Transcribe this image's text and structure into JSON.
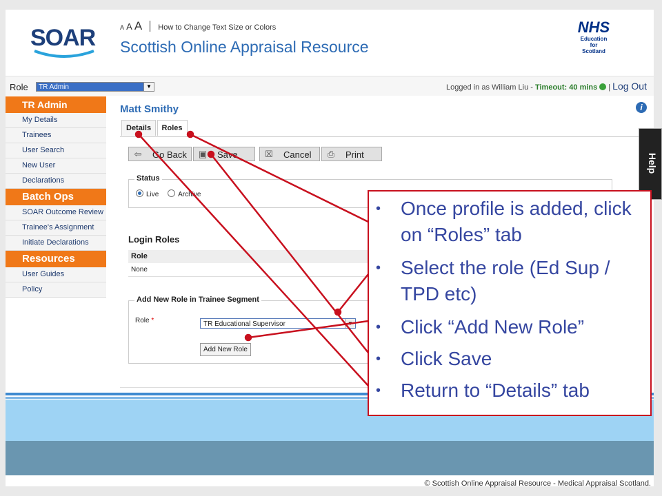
{
  "header": {
    "logo": "SOAR",
    "text_size": {
      "a_small": "A",
      "a_medium": "A",
      "a_large": "A",
      "link": "How to Change Text Size or Colors"
    },
    "site_title": "Scottish Online Appraisal Resource",
    "nhs": {
      "mark": "NHS",
      "line1": "Education",
      "line2": "for",
      "line3": "Scotland"
    }
  },
  "role_bar": {
    "label": "Role",
    "selected": "TR Admin",
    "logged_in": "Logged in as William Liu - ",
    "timeout": "Timeout: 40 mins",
    "logout": "Log Out"
  },
  "sidebar": {
    "sections": [
      {
        "title": "TR Admin",
        "items": [
          "My Details",
          "Trainees",
          "User Search",
          "New User",
          "Declarations"
        ]
      },
      {
        "title": "Batch Ops",
        "items": [
          "SOAR Outcome Review",
          "Trainee's Assignment",
          "Initiate Declarations"
        ]
      },
      {
        "title": "Resources",
        "items": [
          "User Guides",
          "Policy"
        ]
      }
    ]
  },
  "main": {
    "person_name": "Matt Smithy",
    "tabs": [
      {
        "label": "Details"
      },
      {
        "label": "Roles"
      }
    ],
    "toolbar": {
      "go_back": "Go Back",
      "save": "Save",
      "cancel": "Cancel",
      "print": "Print"
    },
    "status": {
      "legend": "Status",
      "live": "Live",
      "archive": "Archive",
      "selected": "Live"
    },
    "login_roles": {
      "title": "Login Roles",
      "column": "Role",
      "rows": [
        "None"
      ]
    },
    "new_role": {
      "legend": "Add New Role in Trainee Segment",
      "role_label": "Role",
      "required_mark": "*",
      "selected": "TR Educational Supervisor",
      "add_button": "Add New Role"
    }
  },
  "help_tab": "Help",
  "footer": {
    "copyright": "© Scottish Online Appraisal Resource - Medical Appraisal Scotland."
  },
  "callout": {
    "bullets": [
      "Once profile is added, click on “Roles” tab",
      "Select the role (Ed Sup / TPD etc)",
      "Click “Add New Role”",
      "Click Save",
      "Return to “Details” tab"
    ]
  },
  "colors": {
    "accent_orange": "#f07818",
    "title_blue": "#2d6bb4",
    "annotation_red": "#c8101e",
    "callout_text": "#3546a0"
  }
}
